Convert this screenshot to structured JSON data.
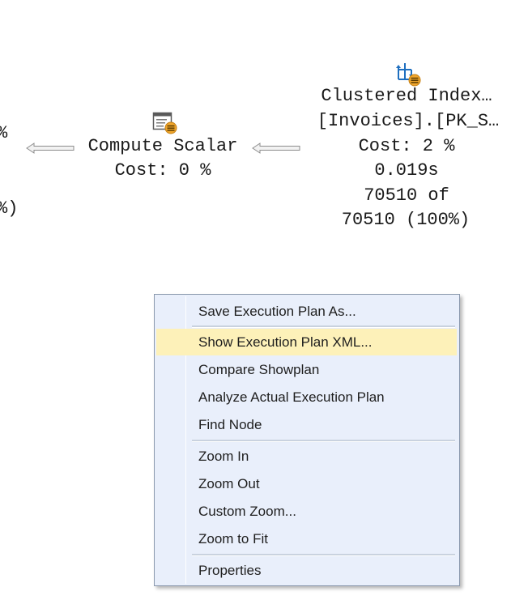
{
  "plan": {
    "left_partial": {
      "line1": "%",
      "line2": "%)"
    },
    "compute_scalar": {
      "icon": "compute-scalar-icon",
      "title": "Compute Scalar",
      "cost": "Cost: 0 %"
    },
    "clustered_index": {
      "icon": "clustered-index-scan-icon",
      "title": "Clustered Index…",
      "object": "[Invoices].[PK_S…",
      "cost": "Cost: 2 %",
      "time": "0.019s",
      "rows_line1": "70510 of",
      "rows_line2": "70510 (100%)"
    }
  },
  "context_menu": {
    "items": [
      {
        "label": "Save Execution Plan As..."
      },
      {
        "label": "Show Execution Plan XML..."
      },
      {
        "label": "Compare Showplan"
      },
      {
        "label": "Analyze Actual Execution Plan"
      },
      {
        "label": "Find Node"
      },
      {
        "label": "Zoom In"
      },
      {
        "label": "Zoom Out"
      },
      {
        "label": "Custom Zoom..."
      },
      {
        "label": "Zoom to Fit"
      },
      {
        "label": "Properties"
      }
    ]
  },
  "colors": {
    "menu_background": "#e9effb",
    "menu_highlight": "#fdf1b9",
    "menu_border": "#8a98ad",
    "icon_blue": "#1f6fbf",
    "icon_orange": "#f0a62c"
  }
}
